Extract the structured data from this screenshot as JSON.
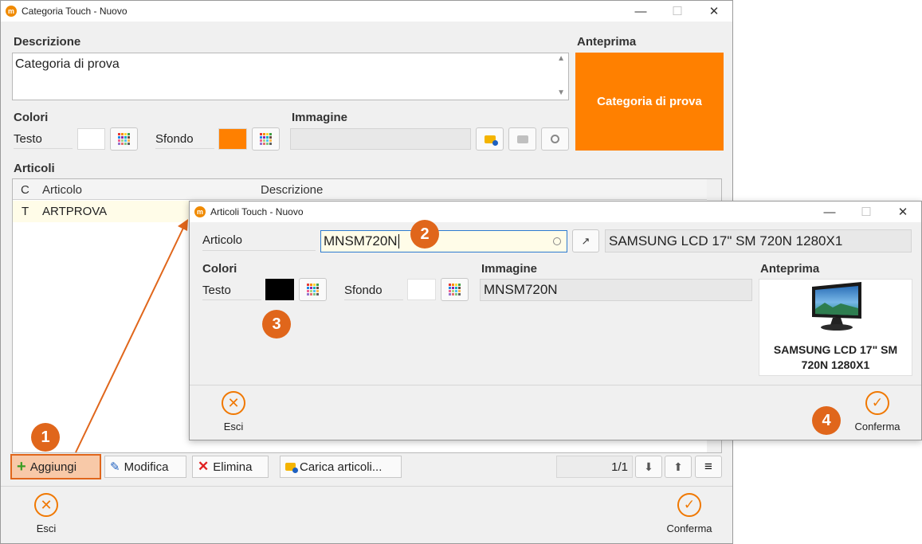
{
  "main": {
    "title": "Categoria Touch - Nuovo",
    "app_icon": "m",
    "descrizione_label": "Descrizione",
    "descrizione_value": "Categoria di prova",
    "anteprima_label": "Anteprima",
    "anteprima_text": "Categoria di prova",
    "colori_label": "Colori",
    "testo_label": "Testo",
    "sfondo_label": "Sfondo",
    "immagine_label": "Immagine",
    "articoli_label": "Articoli",
    "table_headers": [
      "C",
      "Articolo",
      "Descrizione"
    ],
    "rows": [
      {
        "c": "T",
        "articolo": "ARTPROVA",
        "descrizione": ""
      }
    ],
    "btn_aggiungi": "Aggiungi",
    "btn_modifica": "Modifica",
    "btn_elimina": "Elimina",
    "btn_carica": "Carica articoli...",
    "page_indicator": "1/1",
    "esci": "Esci",
    "conferma": "Conferma",
    "colors": {
      "testo": "#ffffff",
      "sfondo": "#ff8000",
      "accent": "#f07800"
    }
  },
  "dialog": {
    "title": "Articoli Touch - Nuovo",
    "articolo_label": "Articolo",
    "articolo_value": "MNSM720N",
    "articolo_desc": "SAMSUNG LCD 17\" SM 720N 1280X1",
    "colori_label": "Colori",
    "testo_label": "Testo",
    "sfondo_label": "Sfondo",
    "immagine_label": "Immagine",
    "immagine_value": "MNSM720N",
    "anteprima_label": "Anteprima",
    "anteprima_caption": "SAMSUNG LCD 17\" SM 720N 1280X1",
    "esci": "Esci",
    "conferma": "Conferma",
    "colors": {
      "testo": "#000000",
      "sfondo": "#ffffff"
    }
  },
  "badges": [
    "1",
    "2",
    "3",
    "4"
  ],
  "window_controls": {
    "minimize": "—",
    "maximize": "☐",
    "close": "✕"
  }
}
